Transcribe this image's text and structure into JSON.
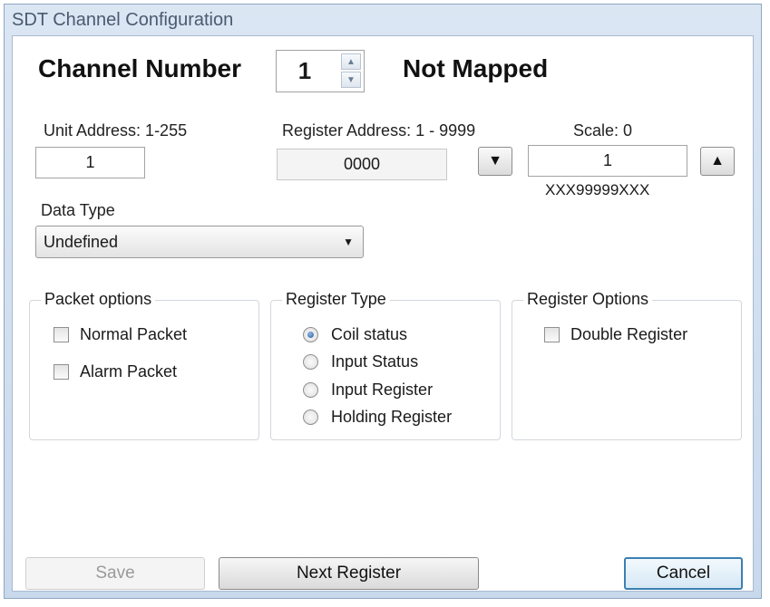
{
  "window": {
    "title": "SDT Channel Configuration"
  },
  "channel": {
    "label": "Channel Number",
    "value": "1",
    "status": "Not Mapped"
  },
  "unit_address": {
    "label": "Unit Address: 1-255",
    "value": "1"
  },
  "register_address": {
    "label": "Register Address: 1 - 9999",
    "value": "0000"
  },
  "scale": {
    "label": "Scale: 0",
    "value": "1",
    "format": "XXX99999XXX",
    "decrease_icon": "triangle-down",
    "increase_icon": "triangle-up"
  },
  "data_type": {
    "label": "Data Type",
    "selected": "Undefined"
  },
  "packet_options": {
    "title": "Packet options",
    "items": [
      {
        "label": "Normal Packet",
        "checked": false
      },
      {
        "label": "Alarm Packet",
        "checked": false
      }
    ]
  },
  "register_type": {
    "title": "Register Type",
    "items": [
      {
        "label": "Coil status",
        "selected": true
      },
      {
        "label": "Input Status",
        "selected": false
      },
      {
        "label": "Input Register",
        "selected": false
      },
      {
        "label": "Holding Register",
        "selected": false
      }
    ]
  },
  "register_options": {
    "title": "Register Options",
    "items": [
      {
        "label": "Double Register",
        "checked": false
      }
    ]
  },
  "buttons": {
    "save": "Save",
    "next": "Next Register",
    "cancel": "Cancel"
  }
}
